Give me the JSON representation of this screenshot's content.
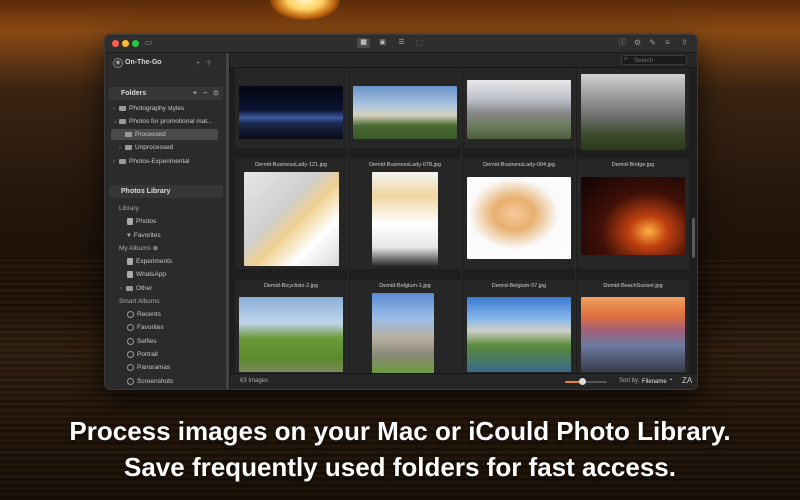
{
  "colors": {
    "accent": "#e08a2a",
    "window_bg": "#232323",
    "sidebar_bg": "#2b2b2b"
  },
  "app": {
    "toolbar_icons": [
      "sidebar-toggle-icon",
      "grid-view-icon",
      "layout-view-icon",
      "list-view-icon",
      "info-icon",
      "settings-icon",
      "tools-icon",
      "filter-icon",
      "share-icon"
    ]
  },
  "account": {
    "name": "On-The-Go",
    "add": "+",
    "help": "?"
  },
  "folders": {
    "header": "Folders",
    "items": [
      {
        "label": "Photography styles"
      },
      {
        "label": "Photos for promotional mat..."
      },
      {
        "label": "Processed",
        "selected": true
      },
      {
        "label": "Unprocessed"
      },
      {
        "label": "Photos-Experimental"
      }
    ]
  },
  "library": {
    "header": "Photos Library",
    "library_label": "Library",
    "library_items": [
      "Photos",
      "Favorites"
    ],
    "albums_label": "My Albums",
    "album_items": [
      "Experiments",
      "WhatsApp",
      "Other"
    ],
    "smart_label": "Smart Albums",
    "smart_items": [
      "Recents",
      "Favorites",
      "Selfies",
      "Portrait",
      "Panoramas",
      "Screenshots"
    ]
  },
  "search": {
    "placeholder": "Search"
  },
  "grid": {
    "captions": [
      "Demid-BusinessLady-121.jpg",
      "Demid-BusinessLady-078.jpg",
      "Demid-BusinessLady-004.jpg",
      "Demid-Bridge.jpg",
      "Demid-Bicyclists-2.jpg",
      "Demid-Belgium-1.jpg",
      "Demid-Belgium-07.jpg",
      "Demid-BeachSunset.jpg"
    ]
  },
  "status": {
    "count": "63 Images",
    "sort_label": "Sort by:",
    "sort_value": "Filename ⌃",
    "order": "ZA",
    "zoom": 0.4
  },
  "tagline": {
    "line1": "Process images on your Mac or iCould Photo Library.",
    "line2": "Save frequently used folders for fast access."
  }
}
